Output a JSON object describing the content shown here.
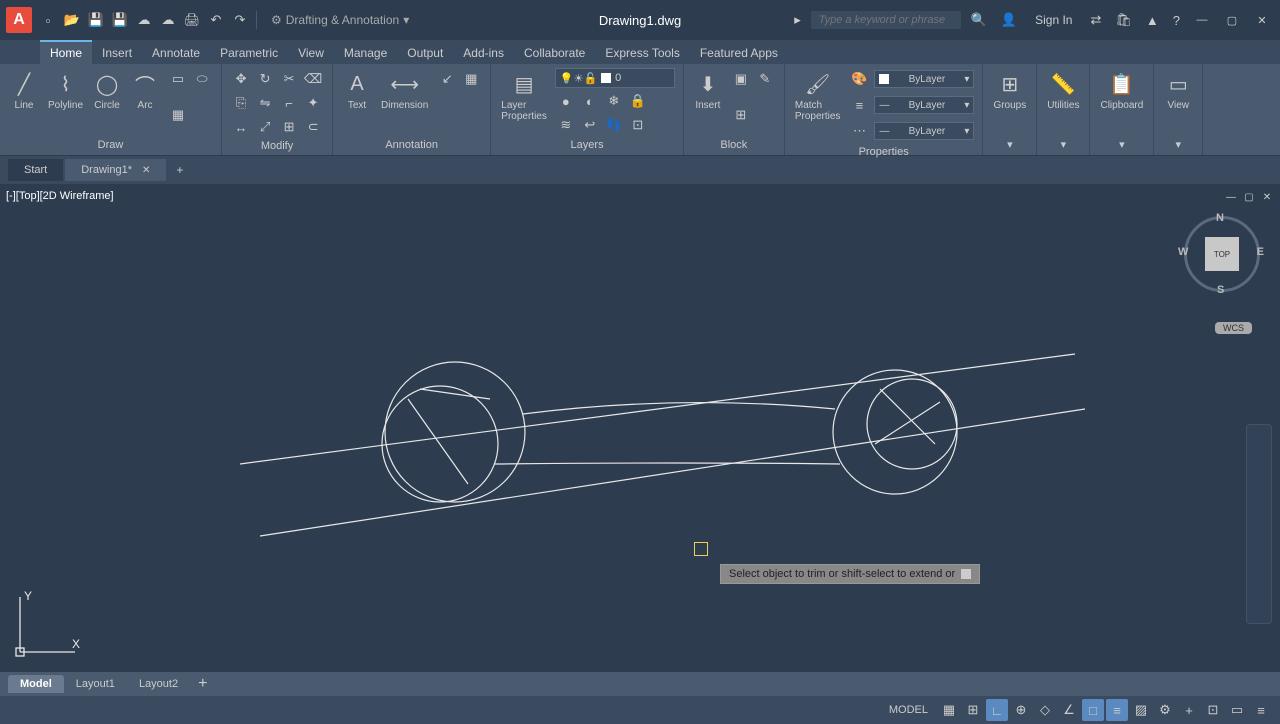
{
  "app": {
    "icon": "A"
  },
  "title": "Drawing1.dwg",
  "workspace": "Drafting & Annotation",
  "search": {
    "placeholder": "Type a keyword or phrase"
  },
  "signin": "Sign In",
  "menu": {
    "tabs": [
      "Home",
      "Insert",
      "Annotate",
      "Parametric",
      "View",
      "Manage",
      "Output",
      "Add-ins",
      "Collaborate",
      "Express Tools",
      "Featured Apps"
    ],
    "active": 0
  },
  "ribbon": {
    "draw": {
      "label": "Draw",
      "line": "Line",
      "polyline": "Polyline",
      "circle": "Circle",
      "arc": "Arc"
    },
    "modify": {
      "label": "Modify"
    },
    "annotation": {
      "label": "Annotation",
      "text": "Text",
      "dimension": "Dimension"
    },
    "layers": {
      "label": "Layers",
      "properties": "Layer\nProperties",
      "current": "0"
    },
    "block": {
      "label": "Block",
      "insert": "Insert"
    },
    "properties": {
      "label": "Properties",
      "match": "Match\nProperties",
      "bylayer": "ByLayer"
    },
    "groups": "Groups",
    "utilities": "Utilities",
    "clipboard": "Clipboard",
    "view": "View"
  },
  "docTabs": {
    "start": "Start",
    "file": "Drawing1*"
  },
  "viewport": {
    "label": "[-][Top][2D Wireframe]",
    "cube_face": "TOP",
    "wcs": "WCS",
    "dirs": {
      "n": "N",
      "s": "S",
      "e": "E",
      "w": "W"
    }
  },
  "prompt": "Select object to trim or shift-select to extend or",
  "ucs": {
    "y": "Y",
    "x": "X"
  },
  "layouts": {
    "model": "Model",
    "l1": "Layout1",
    "l2": "Layout2"
  },
  "status": {
    "model": "MODEL"
  }
}
